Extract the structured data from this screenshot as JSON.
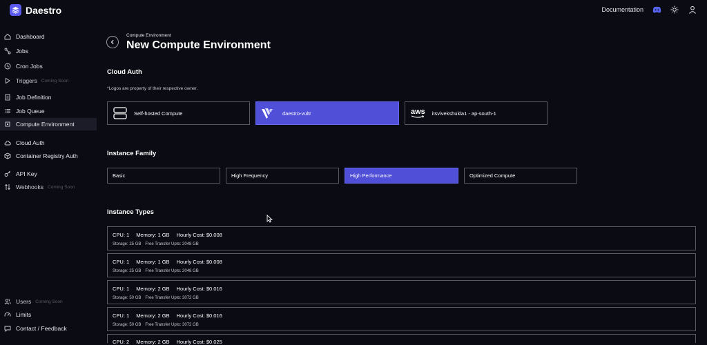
{
  "app": {
    "name": "Daestro"
  },
  "topbar": {
    "documentation_label": "Documentation"
  },
  "sidebar": {
    "items": [
      {
        "label": "Dashboard",
        "icon": "home-icon"
      },
      {
        "label": "Jobs",
        "icon": "jobs-icon"
      },
      {
        "label": "Cron Jobs",
        "icon": "clock-icon"
      },
      {
        "label": "Triggers",
        "badge": "Coming Soon",
        "icon": "play-icon"
      },
      {
        "label": "Job Definition",
        "icon": "document-icon"
      },
      {
        "label": "Job Queue",
        "icon": "list-icon"
      },
      {
        "label": "Compute Environment",
        "icon": "chip-icon",
        "active": true
      },
      {
        "label": "Cloud Auth",
        "icon": "cloud-icon"
      },
      {
        "label": "Container Registry Auth",
        "icon": "box-icon"
      },
      {
        "label": "API Key",
        "icon": "key-icon"
      },
      {
        "label": "Webhooks",
        "badge": "Coming Soon",
        "icon": "arrows-icon"
      }
    ],
    "bottom_items": [
      {
        "label": "Users",
        "badge": "Coming Soon",
        "icon": "users-icon"
      },
      {
        "label": "Limits",
        "icon": "gauge-icon"
      },
      {
        "label": "Contact / Feedback",
        "icon": "chat-icon"
      }
    ]
  },
  "page": {
    "breadcrumb": "Compute Environment",
    "title": "New Compute Environment"
  },
  "cloud_auth": {
    "title": "Cloud Auth",
    "note": "*Logos are property of their respective owner.",
    "options": [
      {
        "label": "Self-hosted Compute",
        "icon": "server-icon"
      },
      {
        "label": "daestro-vultr",
        "icon": "vultr-logo-icon",
        "selected": true
      },
      {
        "label": "itsvivekshukla1 - ap-south-1",
        "icon": "aws-logo-icon",
        "logo_text": "aws"
      }
    ]
  },
  "instance_family": {
    "title": "Instance Family",
    "options": [
      {
        "label": "Basic"
      },
      {
        "label": "High Frequency"
      },
      {
        "label": "High Performance",
        "selected": true
      },
      {
        "label": "Optimized Compute"
      }
    ]
  },
  "instance_types": {
    "title": "Instance Types",
    "items": [
      {
        "cpu": "CPU: 1",
        "memory": "Memory: 1 GB",
        "cost": "Hourly Cost: $0.008",
        "storage": "Storage: 25 GB",
        "transfer": "Free Transfer Upto: 2048 GB"
      },
      {
        "cpu": "CPU: 1",
        "memory": "Memory: 1 GB",
        "cost": "Hourly Cost: $0.008",
        "storage": "Storage: 25 GB",
        "transfer": "Free Transfer Upto: 2048 GB"
      },
      {
        "cpu": "CPU: 1",
        "memory": "Memory: 2 GB",
        "cost": "Hourly Cost: $0.016",
        "storage": "Storage: 50 GB",
        "transfer": "Free Transfer Upto: 3072 GB"
      },
      {
        "cpu": "CPU: 1",
        "memory": "Memory: 2 GB",
        "cost": "Hourly Cost: $0.016",
        "storage": "Storage: 50 GB",
        "transfer": "Free Transfer Upto: 3072 GB"
      },
      {
        "cpu": "CPU: 2",
        "memory": "Memory: 2 GB",
        "cost": "Hourly Cost: $0.025",
        "storage": "",
        "transfer": ""
      }
    ]
  },
  "colors": {
    "accent": "#4f4fd8",
    "background": "#0b0b14",
    "border": "#5a5a66"
  }
}
